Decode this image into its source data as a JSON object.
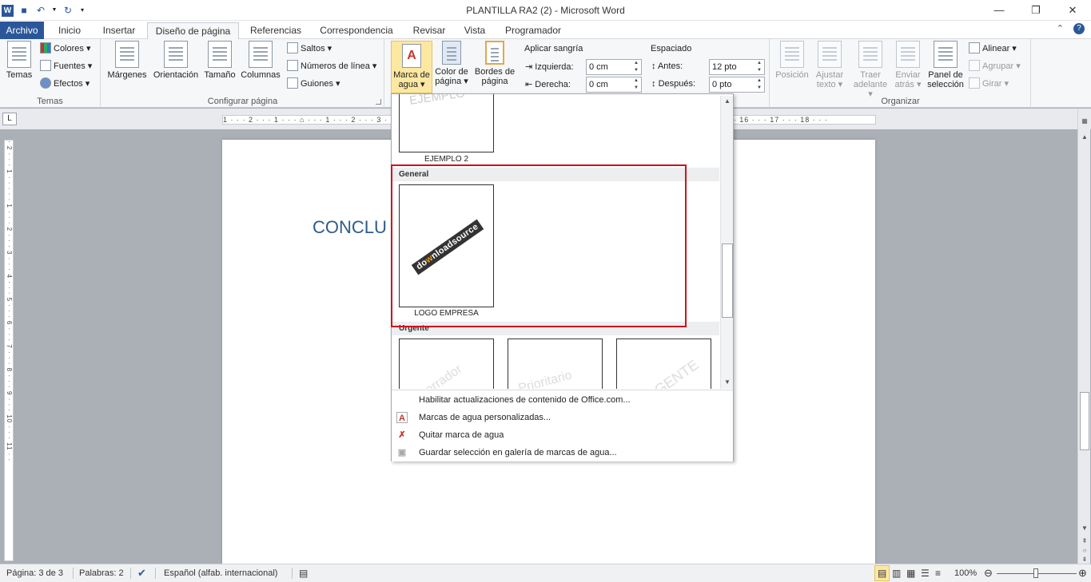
{
  "app": {
    "title": "PLANTILLA RA2 (2)  -  Microsoft Word",
    "logo": "W"
  },
  "tabs": [
    {
      "label": "Archivo"
    },
    {
      "label": "Inicio"
    },
    {
      "label": "Insertar"
    },
    {
      "label": "Diseño de página"
    },
    {
      "label": "Referencias"
    },
    {
      "label": "Correspondencia"
    },
    {
      "label": "Revisar"
    },
    {
      "label": "Vista"
    },
    {
      "label": "Programador"
    }
  ],
  "ribbon": {
    "temas": {
      "group_label": "Temas",
      "temas_button": "Temas",
      "colores": "Colores ▾",
      "fuentes": "Fuentes ▾",
      "efectos": "Efectos ▾"
    },
    "configurar": {
      "group_label": "Configurar página",
      "margenes": "Márgenes",
      "orientacion": "Orientación",
      "tamano": "Tamaño",
      "columnas": "Columnas",
      "saltos": "Saltos ▾",
      "numeros": "Números de línea ▾",
      "guiones": "Guiones ▾"
    },
    "fondo": {
      "marca_line1": "Marca de",
      "marca_line2": "agua ▾",
      "color_line1": "Color de",
      "color_line2": "página ▾",
      "bordes_line1": "Bordes de",
      "bordes_line2": "página"
    },
    "parrafo": {
      "sangria_label": "Aplicar sangría",
      "izquierda_label": "Izquierda:",
      "izquierda_value": "0 cm",
      "derecha_label": "Derecha:",
      "derecha_value": "0 cm",
      "espaciado_label": "Espaciado",
      "antes_label": "Antes:",
      "antes_value": "12 pto",
      "despues_label": "Después:",
      "despues_value": "0 pto"
    },
    "organizar": {
      "group_label": "Organizar",
      "posicion": "Posición",
      "ajustar_line1": "Ajustar",
      "ajustar_line2": "texto ▾",
      "traer_line1": "Traer",
      "traer_line2": "adelante ▾",
      "enviar_line1": "Enviar",
      "enviar_line2": "atrás ▾",
      "panel_line1": "Panel de",
      "panel_line2": "selección",
      "alinear": "Alinear ▾",
      "agrupar": "Agrupar ▾",
      "girar": "Girar ▾"
    }
  },
  "ruler": {
    "horizontal": "1 · · · 2 · · · 1 · · · ⌂ · · · 1 · · · 2 · · · 3 · · · 4 · · · 5 · · · 6 · · · 7 · · · 8 · · · 9 · · · 10 · · · 11 · · · 12 · · · 13 · · · 14 · · · 15 · ⌂ · 16 · · · 17 · · · 18 · · ·",
    "vertical": "· 2 · · · 1 · · · · · 1 · · · 2 · · · 3 · · · 4 · · · 5 · · · 6 · · · 7 · · · 8 · · · 9 · · · 10 · · · 11 · ·"
  },
  "document": {
    "heading": "CONCLU"
  },
  "gallery": {
    "example2_caption": "EJEMPLO 2",
    "example2_partial": "EJEMPLO",
    "section_general": "General",
    "logo_caption": "LOGO EMPRESA",
    "logo_text_a": "do",
    "logo_text_b": "w",
    "logo_text_c": "nloadsource",
    "section_urgente": "Urgente",
    "urgent_wm1": "Borrador",
    "urgent_wm2": "Prioritario",
    "urgent_wm3": "URGENTE",
    "menu": [
      {
        "label": "Habilitar actualizaciones de contenido de Office.com..."
      },
      {
        "label": "Marcas de agua personalizadas..."
      },
      {
        "label": "Quitar marca de agua"
      },
      {
        "label": "Guardar selección en galería de marcas de agua..."
      }
    ]
  },
  "status": {
    "pagina": "Página: 3 de 3",
    "palabras": "Palabras: 2",
    "idioma": "Español (alfab. internacional)",
    "zoom": "100%"
  }
}
